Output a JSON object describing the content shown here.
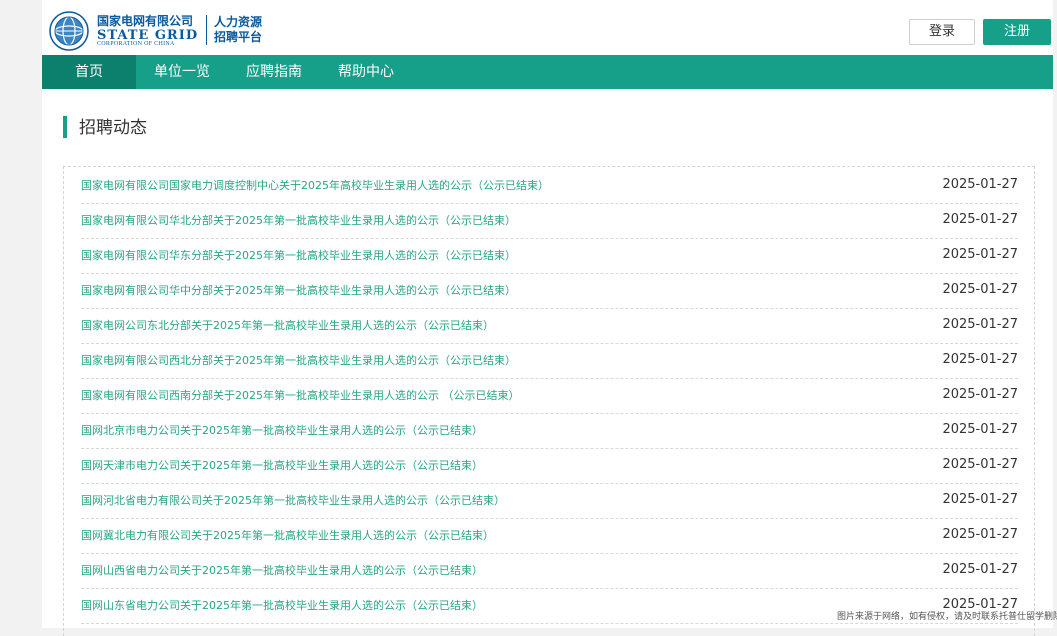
{
  "header": {
    "brand_cn": "国家电网有限公司",
    "brand_en": "STATE GRID",
    "brand_corp": "CORPORATION OF CHINA",
    "platform_line1": "人力资源",
    "platform_line2": "招聘平台",
    "login_label": "登录",
    "register_label": "注册"
  },
  "nav": {
    "items": [
      {
        "label": "首页"
      },
      {
        "label": "单位一览"
      },
      {
        "label": "应聘指南"
      },
      {
        "label": "帮助中心"
      }
    ]
  },
  "section": {
    "title": "招聘动态"
  },
  "news": [
    {
      "title": "国家电网有限公司国家电力调度控制中心关于2025年高校毕业生录用人选的公示（公示已结束）",
      "date": "2025-01-27"
    },
    {
      "title": "国家电网有限公司华北分部关于2025年第一批高校毕业生录用人选的公示（公示已结束）",
      "date": "2025-01-27"
    },
    {
      "title": "国家电网有限公司华东分部关于2025年第一批高校毕业生录用人选的公示（公示已结束）",
      "date": "2025-01-27"
    },
    {
      "title": "国家电网有限公司华中分部关于2025年第一批高校毕业生录用人选的公示（公示已结束）",
      "date": "2025-01-27"
    },
    {
      "title": "国家电网公司东北分部关于2025年第一批高校毕业生录用人选的公示（公示已结束）",
      "date": "2025-01-27"
    },
    {
      "title": "国家电网有限公司西北分部关于2025年第一批高校毕业生录用人选的公示（公示已结束）",
      "date": "2025-01-27"
    },
    {
      "title": "国家电网有限公司西南分部关于2025年第一批高校毕业生录用人选的公示 （公示已结束）",
      "date": "2025-01-27"
    },
    {
      "title": "国网北京市电力公司关于2025年第一批高校毕业生录用人选的公示（公示已结束）",
      "date": "2025-01-27"
    },
    {
      "title": "国网天津市电力公司关于2025年第一批高校毕业生录用人选的公示（公示已结束）",
      "date": "2025-01-27"
    },
    {
      "title": "国网河北省电力有限公司关于2025年第一批高校毕业生录用人选的公示（公示已结束）",
      "date": "2025-01-27"
    },
    {
      "title": "国网冀北电力有限公司关于2025年第一批高校毕业生录用人选的公示（公示已结束）",
      "date": "2025-01-27"
    },
    {
      "title": "国网山西省电力公司关于2025年第一批高校毕业生录用人选的公示（公示已结束）",
      "date": "2025-01-27"
    },
    {
      "title": "国网山东省电力公司关于2025年第一批高校毕业生录用人选的公示（公示已结束）",
      "date": "2025-01-27"
    }
  ],
  "watermark": "图片来源于网络，如有侵权，请及时联系托普仕留学删除",
  "colors": {
    "accent": "#17a089",
    "nav_active": "#0c7f6d",
    "link": "#2aa587",
    "brand": "#0a5a9c"
  },
  "icons": {
    "logo": "state-grid-globe-logo"
  }
}
